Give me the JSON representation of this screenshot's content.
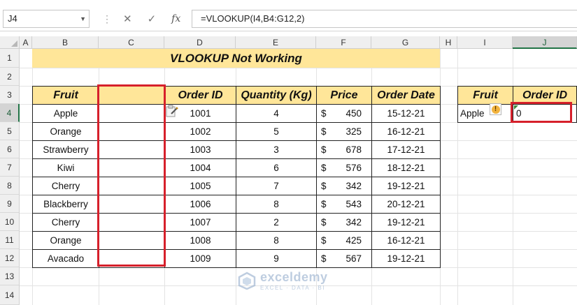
{
  "toolbar": {
    "name_box": "J4",
    "formula": "=VLOOKUP(I4,B4:G12,2)"
  },
  "columns": [
    "A",
    "B",
    "C",
    "D",
    "E",
    "F",
    "G",
    "H",
    "I",
    "J"
  ],
  "rows": [
    "1",
    "2",
    "3",
    "4",
    "5",
    "6",
    "7",
    "8",
    "9",
    "10",
    "11",
    "12",
    "13",
    "14"
  ],
  "sheet": {
    "title": "VLOOKUP Not Working",
    "headers": {
      "fruit": "Fruit",
      "order_id": "Order ID",
      "quantity": "Quantity (Kg)",
      "price": "Price",
      "order_date": "Order Date"
    },
    "data": [
      {
        "fruit": "Apple",
        "order_id": "1001",
        "qty": "4",
        "cur": "$",
        "price": "450",
        "date": "15-12-21"
      },
      {
        "fruit": "Orange",
        "order_id": "1002",
        "qty": "5",
        "cur": "$",
        "price": "325",
        "date": "16-12-21"
      },
      {
        "fruit": "Strawberry",
        "order_id": "1003",
        "qty": "3",
        "cur": "$",
        "price": "678",
        "date": "17-12-21"
      },
      {
        "fruit": "Kiwi",
        "order_id": "1004",
        "qty": "6",
        "cur": "$",
        "price": "576",
        "date": "18-12-21"
      },
      {
        "fruit": "Cherry",
        "order_id": "1005",
        "qty": "7",
        "cur": "$",
        "price": "342",
        "date": "19-12-21"
      },
      {
        "fruit": "Blackberry",
        "order_id": "1006",
        "qty": "8",
        "cur": "$",
        "price": "543",
        "date": "20-12-21"
      },
      {
        "fruit": "Cherry",
        "order_id": "1007",
        "qty": "2",
        "cur": "$",
        "price": "342",
        "date": "19-12-21"
      },
      {
        "fruit": "Orange",
        "order_id": "1008",
        "qty": "8",
        "cur": "$",
        "price": "425",
        "date": "16-12-21"
      },
      {
        "fruit": "Avacado",
        "order_id": "1009",
        "qty": "9",
        "cur": "$",
        "price": "567",
        "date": "19-12-21"
      }
    ],
    "lookup": {
      "header_fruit": "Fruit",
      "header_order_id": "Order ID",
      "fruit": "Apple",
      "result": "0"
    }
  },
  "watermark": {
    "name": "exceldemy",
    "tagline": "EXCEL · DATA · BI"
  },
  "colors": {
    "header_fill": "#ffe699",
    "highlight_border": "#d6202b",
    "selected_accent": "#217346"
  },
  "icons": [
    "dropdown-arrow-icon",
    "cancel-icon",
    "enter-icon",
    "function-icon",
    "paste-options-icon",
    "error-warning-icon",
    "watermark-logo-icon"
  ]
}
